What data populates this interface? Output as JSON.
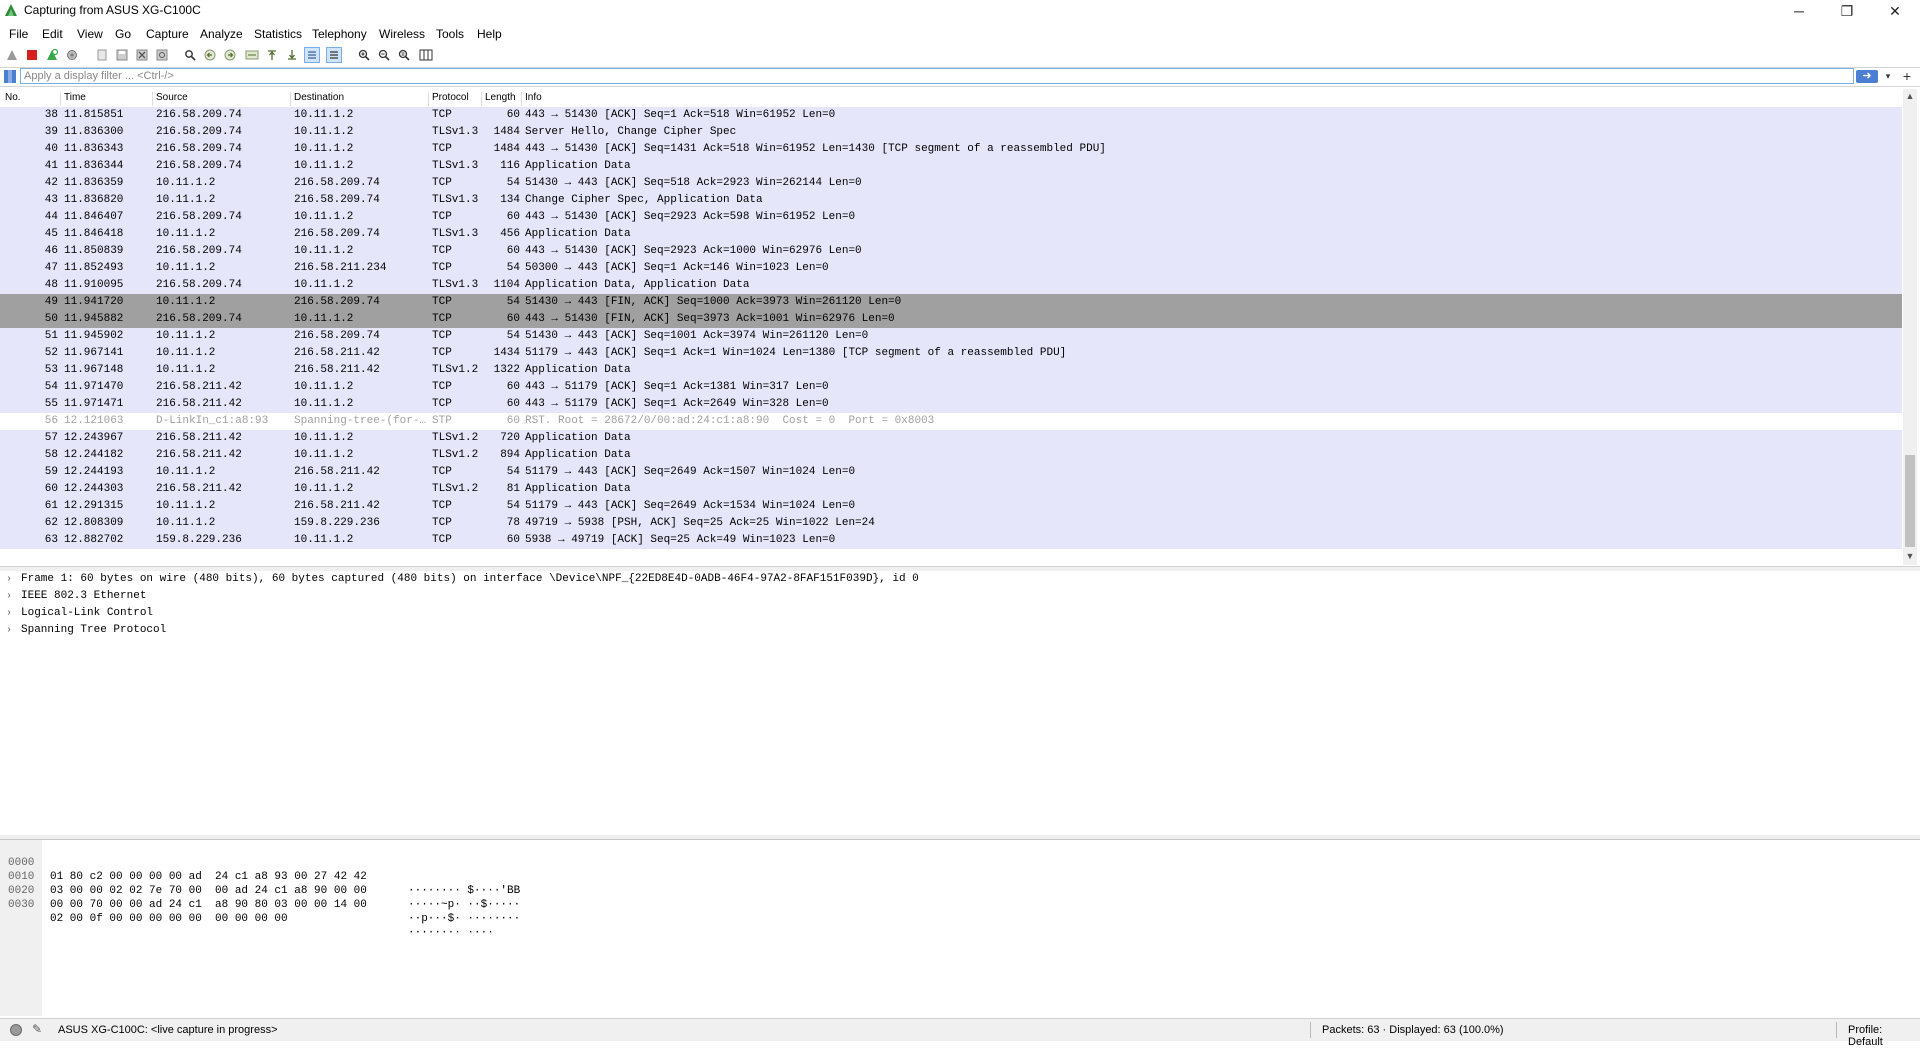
{
  "window": {
    "title": "Capturing from ASUS XG-C100C",
    "minimize": "─",
    "maximize": "❐",
    "close": "✕"
  },
  "menu": [
    "File",
    "Edit",
    "View",
    "Go",
    "Capture",
    "Analyze",
    "Statistics",
    "Telephony",
    "Wireless",
    "Tools",
    "Help"
  ],
  "toolbar_icons": [
    "shark-fin-start-icon",
    "stop-icon",
    "restart-icon",
    "capture-options-icon",
    "open-file-icon",
    "save-file-icon",
    "close-file-icon",
    "reload-file-icon",
    "find-packet-icon",
    "go-back-icon",
    "go-forward-icon",
    "go-to-packet-icon",
    "go-first-icon",
    "go-last-icon",
    "autoscroll-icon",
    "colorize-icon",
    "zoom-in-icon",
    "zoom-out-icon",
    "zoom-normal-icon",
    "resize-columns-icon"
  ],
  "filter": {
    "placeholder": "Apply a display filter ... <Ctrl-/>",
    "value": ""
  },
  "columns": [
    "No.",
    "Time",
    "Source",
    "Destination",
    "Protocol",
    "Length",
    "Info"
  ],
  "packets": [
    {
      "no": "38",
      "time": "11.815851",
      "src": "216.58.209.74",
      "dst": "10.11.1.2",
      "proto": "TCP",
      "len": "60",
      "info": "443 → 51430 [ACK] Seq=1 Ack=518 Win=61952 Len=0",
      "style": "normal"
    },
    {
      "no": "39",
      "time": "11.836300",
      "src": "216.58.209.74",
      "dst": "10.11.1.2",
      "proto": "TLSv1.3",
      "len": "1484",
      "info": "Server Hello, Change Cipher Spec",
      "style": "normal"
    },
    {
      "no": "40",
      "time": "11.836343",
      "src": "216.58.209.74",
      "dst": "10.11.1.2",
      "proto": "TCP",
      "len": "1484",
      "info": "443 → 51430 [ACK] Seq=1431 Ack=518 Win=61952 Len=1430 [TCP segment of a reassembled PDU]",
      "style": "normal"
    },
    {
      "no": "41",
      "time": "11.836344",
      "src": "216.58.209.74",
      "dst": "10.11.1.2",
      "proto": "TLSv1.3",
      "len": "116",
      "info": "Application Data",
      "style": "normal"
    },
    {
      "no": "42",
      "time": "11.836359",
      "src": "10.11.1.2",
      "dst": "216.58.209.74",
      "proto": "TCP",
      "len": "54",
      "info": "51430 → 443 [ACK] Seq=518 Ack=2923 Win=262144 Len=0",
      "style": "normal"
    },
    {
      "no": "43",
      "time": "11.836820",
      "src": "10.11.1.2",
      "dst": "216.58.209.74",
      "proto": "TLSv1.3",
      "len": "134",
      "info": "Change Cipher Spec, Application Data",
      "style": "normal"
    },
    {
      "no": "44",
      "time": "11.846407",
      "src": "216.58.209.74",
      "dst": "10.11.1.2",
      "proto": "TCP",
      "len": "60",
      "info": "443 → 51430 [ACK] Seq=2923 Ack=598 Win=61952 Len=0",
      "style": "normal"
    },
    {
      "no": "45",
      "time": "11.846418",
      "src": "10.11.1.2",
      "dst": "216.58.209.74",
      "proto": "TLSv1.3",
      "len": "456",
      "info": "Application Data",
      "style": "normal"
    },
    {
      "no": "46",
      "time": "11.850839",
      "src": "216.58.209.74",
      "dst": "10.11.1.2",
      "proto": "TCP",
      "len": "60",
      "info": "443 → 51430 [ACK] Seq=2923 Ack=1000 Win=62976 Len=0",
      "style": "normal"
    },
    {
      "no": "47",
      "time": "11.852493",
      "src": "10.11.1.2",
      "dst": "216.58.211.234",
      "proto": "TCP",
      "len": "54",
      "info": "50300 → 443 [ACK] Seq=1 Ack=146 Win=1023 Len=0",
      "style": "normal"
    },
    {
      "no": "48",
      "time": "11.910095",
      "src": "216.58.209.74",
      "dst": "10.11.1.2",
      "proto": "TLSv1.3",
      "len": "1104",
      "info": "Application Data, Application Data",
      "style": "normal"
    },
    {
      "no": "49",
      "time": "11.941720",
      "src": "10.11.1.2",
      "dst": "216.58.209.74",
      "proto": "TCP",
      "len": "54",
      "info": "51430 → 443 [FIN, ACK] Seq=1000 Ack=3973 Win=261120 Len=0",
      "style": "sel"
    },
    {
      "no": "50",
      "time": "11.945882",
      "src": "216.58.209.74",
      "dst": "10.11.1.2",
      "proto": "TCP",
      "len": "60",
      "info": "443 → 51430 [FIN, ACK] Seq=3973 Ack=1001 Win=62976 Len=0",
      "style": "sel"
    },
    {
      "no": "51",
      "time": "11.945902",
      "src": "10.11.1.2",
      "dst": "216.58.209.74",
      "proto": "TCP",
      "len": "54",
      "info": "51430 → 443 [ACK] Seq=1001 Ack=3974 Win=261120 Len=0",
      "style": "normal"
    },
    {
      "no": "52",
      "time": "11.967141",
      "src": "10.11.1.2",
      "dst": "216.58.211.42",
      "proto": "TCP",
      "len": "1434",
      "info": "51179 → 443 [ACK] Seq=1 Ack=1 Win=1024 Len=1380 [TCP segment of a reassembled PDU]",
      "style": "normal"
    },
    {
      "no": "53",
      "time": "11.967148",
      "src": "10.11.1.2",
      "dst": "216.58.211.42",
      "proto": "TLSv1.2",
      "len": "1322",
      "info": "Application Data",
      "style": "normal"
    },
    {
      "no": "54",
      "time": "11.971470",
      "src": "216.58.211.42",
      "dst": "10.11.1.2",
      "proto": "TCP",
      "len": "60",
      "info": "443 → 51179 [ACK] Seq=1 Ack=1381 Win=317 Len=0",
      "style": "normal"
    },
    {
      "no": "55",
      "time": "11.971471",
      "src": "216.58.211.42",
      "dst": "10.11.1.2",
      "proto": "TCP",
      "len": "60",
      "info": "443 → 51179 [ACK] Seq=1 Ack=2649 Win=328 Len=0",
      "style": "normal"
    },
    {
      "no": "56",
      "time": "12.121063",
      "src": "D-LinkIn_c1:a8:93",
      "dst": "Spanning-tree-(for-…",
      "proto": "STP",
      "len": "60",
      "info": "RST. Root = 28672/0/00:ad:24:c1:a8:90  Cost = 0  Port = 0x8003",
      "style": "stp"
    },
    {
      "no": "57",
      "time": "12.243967",
      "src": "216.58.211.42",
      "dst": "10.11.1.2",
      "proto": "TLSv1.2",
      "len": "720",
      "info": "Application Data",
      "style": "normal"
    },
    {
      "no": "58",
      "time": "12.244182",
      "src": "216.58.211.42",
      "dst": "10.11.1.2",
      "proto": "TLSv1.2",
      "len": "894",
      "info": "Application Data",
      "style": "normal"
    },
    {
      "no": "59",
      "time": "12.244193",
      "src": "10.11.1.2",
      "dst": "216.58.211.42",
      "proto": "TCP",
      "len": "54",
      "info": "51179 → 443 [ACK] Seq=2649 Ack=1507 Win=1024 Len=0",
      "style": "normal"
    },
    {
      "no": "60",
      "time": "12.244303",
      "src": "216.58.211.42",
      "dst": "10.11.1.2",
      "proto": "TLSv1.2",
      "len": "81",
      "info": "Application Data",
      "style": "normal"
    },
    {
      "no": "61",
      "time": "12.291315",
      "src": "10.11.1.2",
      "dst": "216.58.211.42",
      "proto": "TCP",
      "len": "54",
      "info": "51179 → 443 [ACK] Seq=2649 Ack=1534 Win=1024 Len=0",
      "style": "normal"
    },
    {
      "no": "62",
      "time": "12.808309",
      "src": "10.11.1.2",
      "dst": "159.8.229.236",
      "proto": "TCP",
      "len": "78",
      "info": "49719 → 5938 [PSH, ACK] Seq=25 Ack=25 Win=1022 Len=24",
      "style": "normal"
    },
    {
      "no": "63",
      "time": "12.882702",
      "src": "159.8.229.236",
      "dst": "10.11.1.2",
      "proto": "TCP",
      "len": "60",
      "info": "5938 → 49719 [ACK] Seq=25 Ack=49 Win=1023 Len=0",
      "style": "normal"
    }
  ],
  "details": [
    "Frame 1: 60 bytes on wire (480 bits), 60 bytes captured (480 bits) on interface \\Device\\NPF_{22ED8E4D-0ADB-46F4-97A2-8FAF151F039D}, id 0",
    "IEEE 802.3 Ethernet",
    "Logical-Link Control",
    "Spanning Tree Protocol"
  ],
  "bytes": [
    {
      "off": "0000",
      "hex": "01 80 c2 00 00 00 00 ad  24 c1 a8 93 00 27 42 42",
      "ascii": "········ $····'BB"
    },
    {
      "off": "0010",
      "hex": "03 00 00 02 02 7e 70 00  00 ad 24 c1 a8 90 00 00",
      "ascii": "·····~p· ··$·····"
    },
    {
      "off": "0020",
      "hex": "00 00 70 00 00 ad 24 c1  a8 90 80 03 00 00 14 00",
      "ascii": "··p···$· ········"
    },
    {
      "off": "0030",
      "hex": "02 00 0f 00 00 00 00 00  00 00 00 00",
      "ascii": "········ ····"
    }
  ],
  "status": {
    "message": "ASUS XG-C100C: <live capture in progress>",
    "packets": "Packets: 63 · Displayed: 63 (100.0%)",
    "profile": "Profile: Default"
  },
  "colors": {
    "tcp_row": "#e6e6fa",
    "selected_row": "#a0a0a0",
    "stp_row_text": "#a0a0a0"
  }
}
